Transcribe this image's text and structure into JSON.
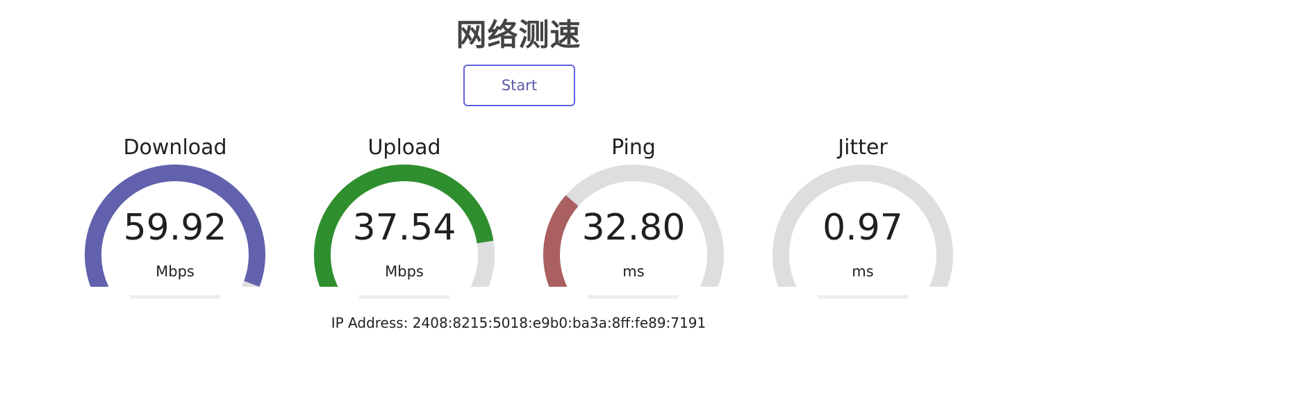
{
  "page": {
    "title": "网络测速",
    "start_label": "Start"
  },
  "colors": {
    "track": "#dedede",
    "download": "#6161ad",
    "upload": "#2f8f2f",
    "ping": "#aa5f60",
    "jitter": "#aa5f60",
    "button_border": "#6060e0",
    "button_text": "#5a5aa8"
  },
  "gauges": [
    {
      "id": "download",
      "label": "Download",
      "value": "59.92",
      "unit": "Mbps",
      "fill_fraction": 0.91,
      "progress_fraction": 0,
      "color": "#6161ad"
    },
    {
      "id": "upload",
      "label": "Upload",
      "value": "37.54",
      "unit": "Mbps",
      "fill_fraction": 0.8,
      "progress_fraction": 0,
      "color": "#2f8f2f"
    },
    {
      "id": "ping",
      "label": "Ping",
      "value": "32.80",
      "unit": "ms",
      "fill_fraction": 0.32,
      "progress_fraction": 0,
      "color": "#aa5f60"
    },
    {
      "id": "jitter",
      "label": "Jitter",
      "value": "0.97",
      "unit": "ms",
      "fill_fraction": 0.06,
      "progress_fraction": 0,
      "color": "#aa5f60"
    }
  ],
  "ip": {
    "label": "IP Address:",
    "value": "2408:8215:5018:e9b0:ba3a:8ff:fe89:7191"
  }
}
